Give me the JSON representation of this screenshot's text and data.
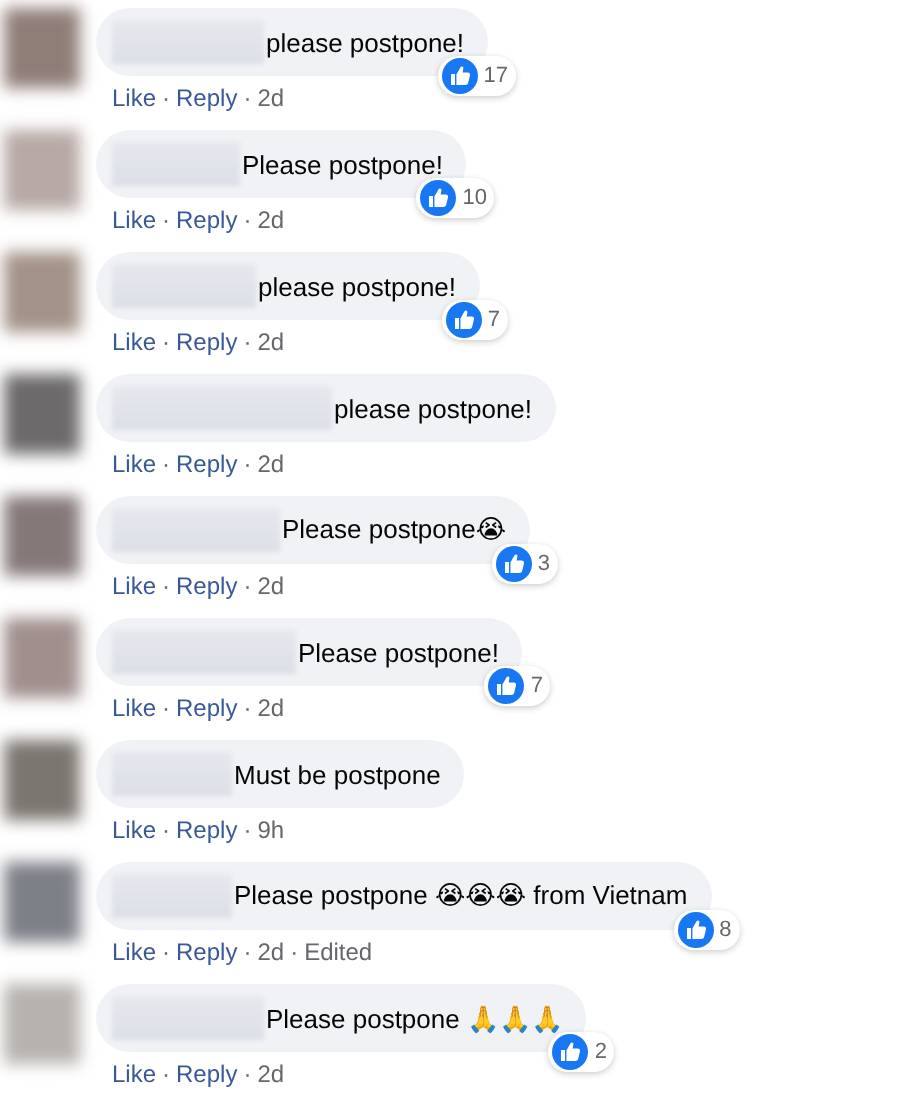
{
  "comments": [
    {
      "text": "please postpone!",
      "reactions": "17",
      "meta": [
        {
          "kind": "link",
          "text": "Like"
        },
        {
          "kind": "sep",
          "text": "·"
        },
        {
          "kind": "link",
          "text": "Reply"
        },
        {
          "kind": "sep",
          "text": "·"
        },
        {
          "kind": "time",
          "text": "2d"
        }
      ]
    },
    {
      "text": "Please postpone!",
      "reactions": "10",
      "meta": [
        {
          "kind": "link",
          "text": "Like"
        },
        {
          "kind": "sep",
          "text": "·"
        },
        {
          "kind": "link",
          "text": "Reply"
        },
        {
          "kind": "sep",
          "text": "·"
        },
        {
          "kind": "time",
          "text": "2d"
        }
      ]
    },
    {
      "text": "please postpone!",
      "reactions": "7",
      "meta": [
        {
          "kind": "link",
          "text": "Like"
        },
        {
          "kind": "sep",
          "text": "·"
        },
        {
          "kind": "link",
          "text": "Reply"
        },
        {
          "kind": "sep",
          "text": "·"
        },
        {
          "kind": "time",
          "text": "2d"
        }
      ]
    },
    {
      "text": "please postpone!",
      "meta": [
        {
          "kind": "link",
          "text": "Like"
        },
        {
          "kind": "sep",
          "text": "·"
        },
        {
          "kind": "link",
          "text": "Reply"
        },
        {
          "kind": "sep",
          "text": "·"
        },
        {
          "kind": "time",
          "text": "2d"
        }
      ]
    },
    {
      "text": "Please postpone😭",
      "reactions": "3",
      "meta": [
        {
          "kind": "link",
          "text": "Like"
        },
        {
          "kind": "sep",
          "text": "·"
        },
        {
          "kind": "link",
          "text": "Reply"
        },
        {
          "kind": "sep",
          "text": "·"
        },
        {
          "kind": "time",
          "text": "2d"
        }
      ]
    },
    {
      "text": "Please postpone!",
      "reactions": "7",
      "meta": [
        {
          "kind": "link",
          "text": "Like"
        },
        {
          "kind": "sep",
          "text": "·"
        },
        {
          "kind": "link",
          "text": "Reply"
        },
        {
          "kind": "sep",
          "text": "·"
        },
        {
          "kind": "time",
          "text": "2d"
        }
      ]
    },
    {
      "text": "Must be postpone",
      "meta": [
        {
          "kind": "link",
          "text": "Like"
        },
        {
          "kind": "sep",
          "text": "·"
        },
        {
          "kind": "link",
          "text": "Reply"
        },
        {
          "kind": "sep",
          "text": "·"
        },
        {
          "kind": "time",
          "text": "9h"
        }
      ]
    },
    {
      "text": "Please postpone 😭😭😭 from Vietnam",
      "reactions": "8",
      "meta": [
        {
          "kind": "link",
          "text": "Like"
        },
        {
          "kind": "sep",
          "text": "·"
        },
        {
          "kind": "link",
          "text": "Reply"
        },
        {
          "kind": "sep",
          "text": "·"
        },
        {
          "kind": "time",
          "text": "2d"
        },
        {
          "kind": "sep",
          "text": "·"
        },
        {
          "kind": "time",
          "text": "Edited"
        }
      ]
    },
    {
      "text": "Please postpone 🙏🙏🙏",
      "reactions": "2",
      "meta": [
        {
          "kind": "link",
          "text": "Like"
        },
        {
          "kind": "sep",
          "text": "·"
        },
        {
          "kind": "link",
          "text": "Reply"
        },
        {
          "kind": "sep",
          "text": "·"
        },
        {
          "kind": "time",
          "text": "2d"
        }
      ]
    }
  ]
}
